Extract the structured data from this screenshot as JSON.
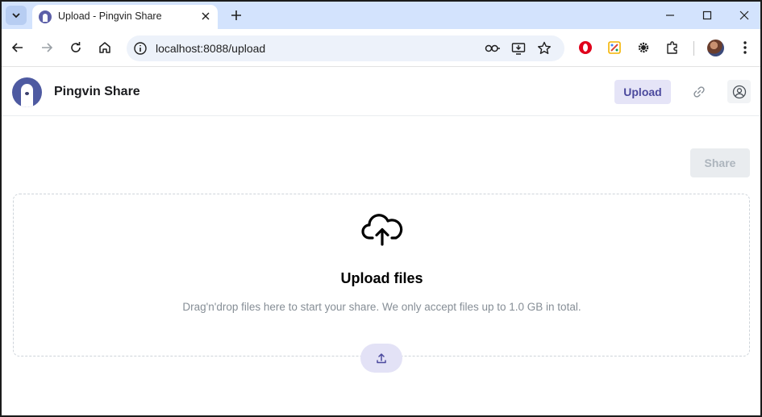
{
  "browser": {
    "tab_title": "Upload - Pingvin Share",
    "url": "localhost:8088/upload"
  },
  "app": {
    "brand": "Pingvin Share",
    "header_upload_label": "Upload"
  },
  "main": {
    "share_label": "Share",
    "dropzone_title": "Upload files",
    "dropzone_description": "Drag'n'drop files here to start your share. We only accept files up to 1.0 GB in total."
  },
  "colors": {
    "accent": "#4c4a9e",
    "accent_light": "#e5e4f7",
    "tabstrip": "#d3e3fd"
  }
}
